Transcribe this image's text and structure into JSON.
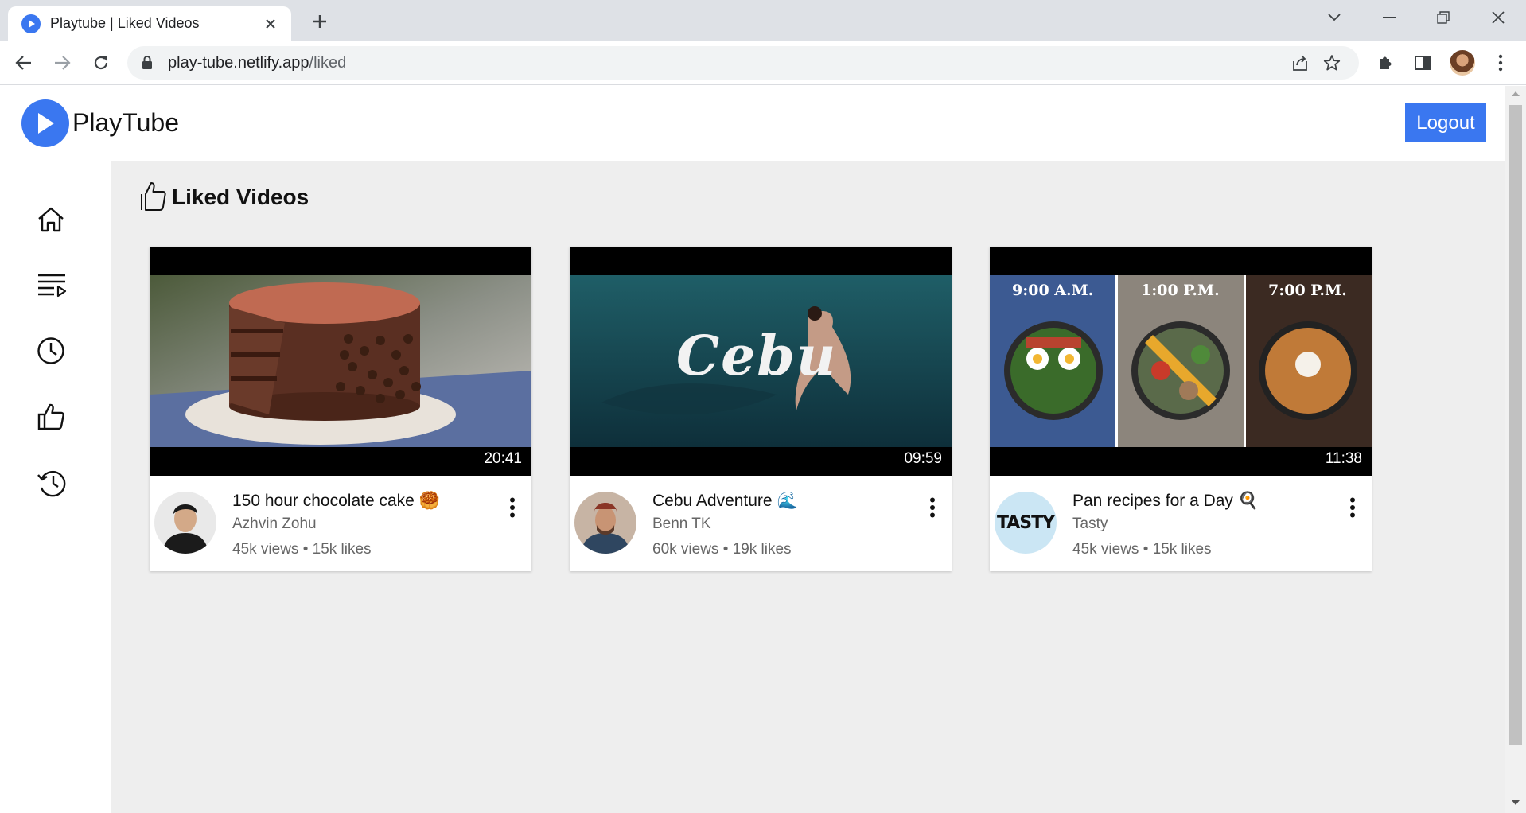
{
  "browser": {
    "tab_title": "Playtube | Liked Videos",
    "url_host": "play-tube.netlify.app",
    "url_path": "/liked"
  },
  "app": {
    "logo_text": "PlayTube",
    "logout_label": "Logout",
    "accent_color": "#3a77f0"
  },
  "sidebar": {
    "items": [
      {
        "icon": "home-icon"
      },
      {
        "icon": "playlist-icon"
      },
      {
        "icon": "watch-later-icon"
      },
      {
        "icon": "liked-icon"
      },
      {
        "icon": "history-icon"
      }
    ]
  },
  "section": {
    "title": "Liked Videos"
  },
  "videos": [
    {
      "title": "150 hour chocolate cake 🥮",
      "channel": "Azhvin Zohu",
      "stats": "45k views • 15k likes",
      "duration": "20:41"
    },
    {
      "title": "Cebu Adventure 🌊",
      "channel": "Benn TK",
      "stats": "60k views • 19k likes",
      "duration": "09:59",
      "thumb_text": "Cebu"
    },
    {
      "title": "Pan recipes for a Day 🍳",
      "channel": "Tasty",
      "stats": "45k views • 15k likes",
      "duration": "11:38",
      "thumb_labels": [
        "9:00 A.M.",
        "1:00 P.M.",
        "7:00 P.M."
      ],
      "avatar_text": "TASTY"
    }
  ]
}
